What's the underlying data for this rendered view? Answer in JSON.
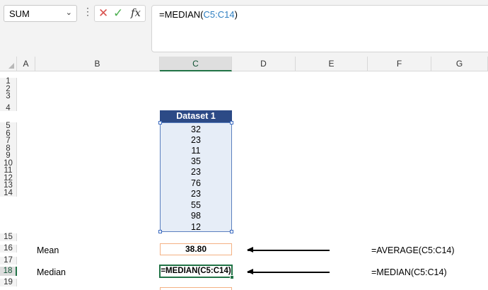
{
  "name_box": {
    "value": "SUM"
  },
  "formula_bar": {
    "prefix": "=MEDIAN(",
    "ref": "C5:C14",
    "suffix": ")"
  },
  "columns": [
    "A",
    "B",
    "C",
    "D",
    "E",
    "F",
    "G"
  ],
  "selected_column": "C",
  "rows": [
    "1",
    "2",
    "3",
    "4",
    "5",
    "6",
    "7",
    "8",
    "9",
    "10",
    "11",
    "12",
    "13",
    "14",
    "15",
    "16",
    "17",
    "18",
    "19"
  ],
  "selected_row": "18",
  "dataset": {
    "header": "Dataset 1",
    "values": [
      "32",
      "23",
      "11",
      "35",
      "23",
      "76",
      "23",
      "55",
      "98",
      "12"
    ]
  },
  "mean": {
    "label": "Mean",
    "value": "38.80",
    "formula_text": "=AVERAGE(C5:C14)"
  },
  "median": {
    "label": "Median",
    "edit_text": "=MEDIAN(C5:C14)",
    "formula_text": "=MEDIAN(C5:C14)"
  },
  "colors": {
    "header_fill": "#2c4a86",
    "range_fill": "#e6edf7",
    "accent_green": "#217346",
    "cell_border_orange": "#f4b183"
  },
  "icons": {
    "cancel": "close-icon",
    "enter": "check-icon",
    "insert_function": "fx-icon",
    "dropdown": "chevron-down-icon"
  }
}
